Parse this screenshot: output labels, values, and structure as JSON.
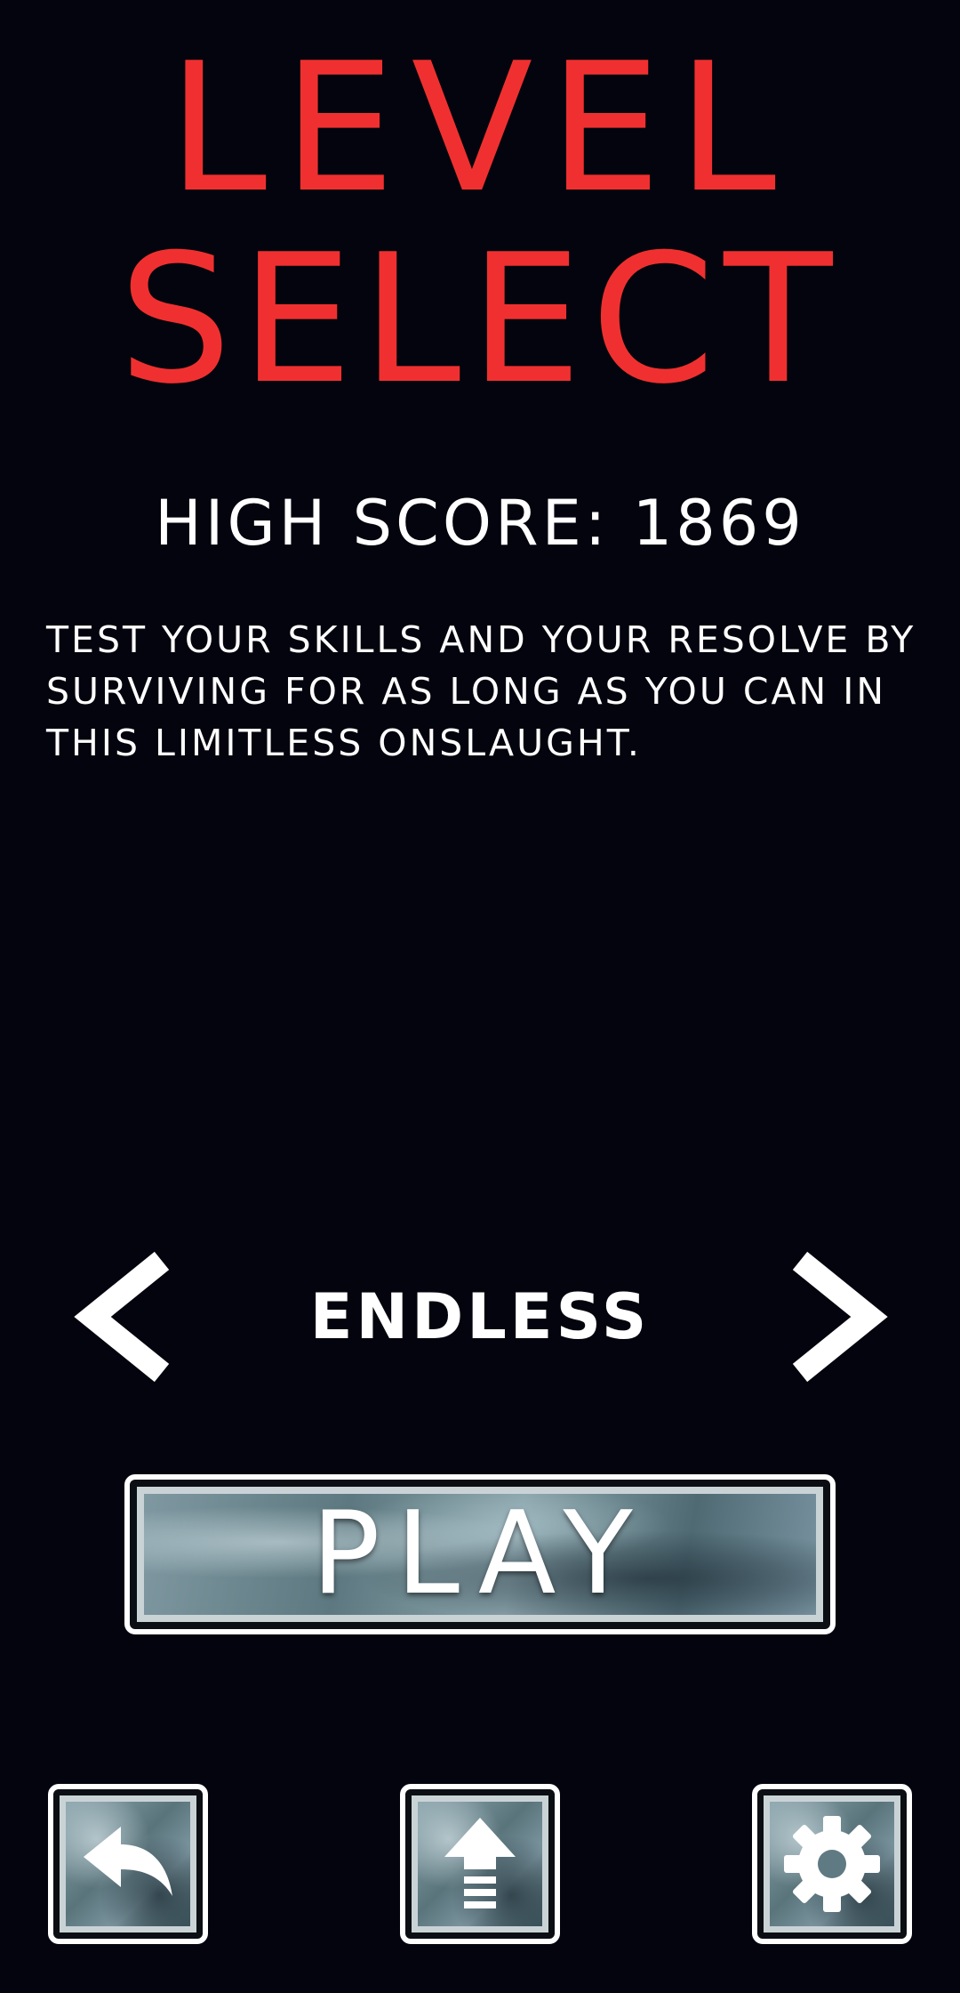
{
  "title": {
    "line1": "LEVEL",
    "line2": "SELECT",
    "color": "#f03030"
  },
  "high_score": {
    "text": "HIGH SCORE: 1869"
  },
  "description": {
    "text": "TEST YOUR SKILLS AND YOUR RESOLVE BY SURVIVING FOR AS LONG AS YOU CAN IN THIS LIMITLESS ONSLAUGHT."
  },
  "mode_selector": {
    "current": "ENDLESS",
    "prev_icon": "chevron-left-icon",
    "next_icon": "chevron-right-icon"
  },
  "play_button": {
    "label": "PLAY"
  },
  "bottom_bar": {
    "buttons": [
      {
        "name": "back",
        "icon": "back-arrow-icon"
      },
      {
        "name": "upgrade",
        "icon": "upgrade-arrow-icon"
      },
      {
        "name": "settings",
        "icon": "gear-icon"
      }
    ]
  },
  "colors": {
    "background": "#03040d",
    "text": "#ffffff",
    "accent": "#f03030"
  }
}
